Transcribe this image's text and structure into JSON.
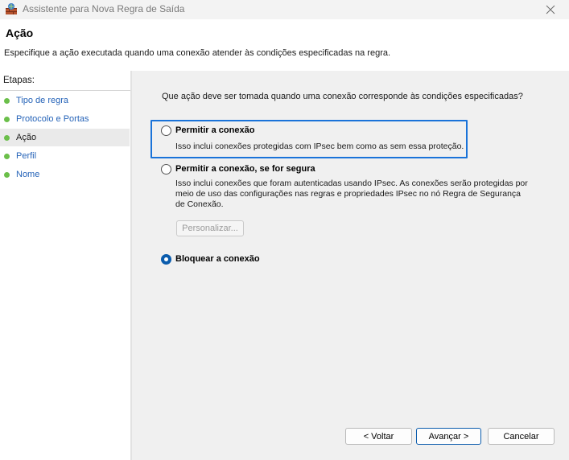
{
  "window": {
    "title": "Assistente para Nova Regra de Saída",
    "icon": "firewall-icon"
  },
  "header": {
    "title": "Ação",
    "description": "Especifique a ação executada quando uma conexão atender às condições especificadas na regra."
  },
  "steps": {
    "title": "Etapas:",
    "items": [
      {
        "label": "Tipo de regra",
        "active": false
      },
      {
        "label": "Protocolo e Portas",
        "active": false
      },
      {
        "label": "Ação",
        "active": true
      },
      {
        "label": "Perfil",
        "active": false
      },
      {
        "label": "Nome",
        "active": false
      }
    ]
  },
  "main": {
    "question": "Que ação deve ser tomada quando uma conexão corresponde às condições especificadas?",
    "options": [
      {
        "label": "Permitir a conexão",
        "description": "Isso inclui conexões protegidas com IPsec bem como as sem essa proteção.",
        "selected": false
      },
      {
        "label": "Permitir a conexão, se for segura",
        "description": "Isso inclui conexões que foram autenticadas usando IPsec. As conexões serão protegidas por meio de uso das configurações nas regras e propriedades IPsec no nó Regra de Segurança de Conexão.",
        "selected": false
      },
      {
        "label": "Bloquear a conexão",
        "description": "",
        "selected": true
      }
    ],
    "customize_label": "Personalizar..."
  },
  "footer": {
    "back_label": "< Voltar",
    "next_label": "Avançar >",
    "cancel_label": "Cancelar"
  },
  "colors": {
    "accent": "#0b5cad",
    "focus": "#1a73d9",
    "step_dot": "#6bbf4a",
    "link": "#2563b8"
  }
}
